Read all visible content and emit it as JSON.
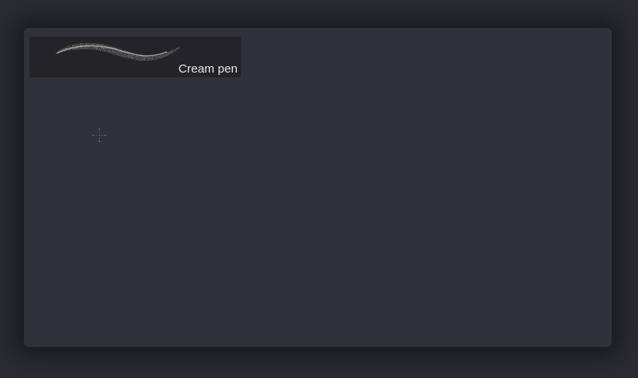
{
  "brush_library": {
    "selected_brush": {
      "name": "Cream pen",
      "icon": "brush-stroke-preview"
    }
  },
  "canvas": {
    "cursor_icon": "crosshair-cursor-icon"
  },
  "colors": {
    "background": "#2a2b32",
    "panel": "#30313a",
    "preview_background": "#242327",
    "label_text": "#e6e6e8"
  }
}
